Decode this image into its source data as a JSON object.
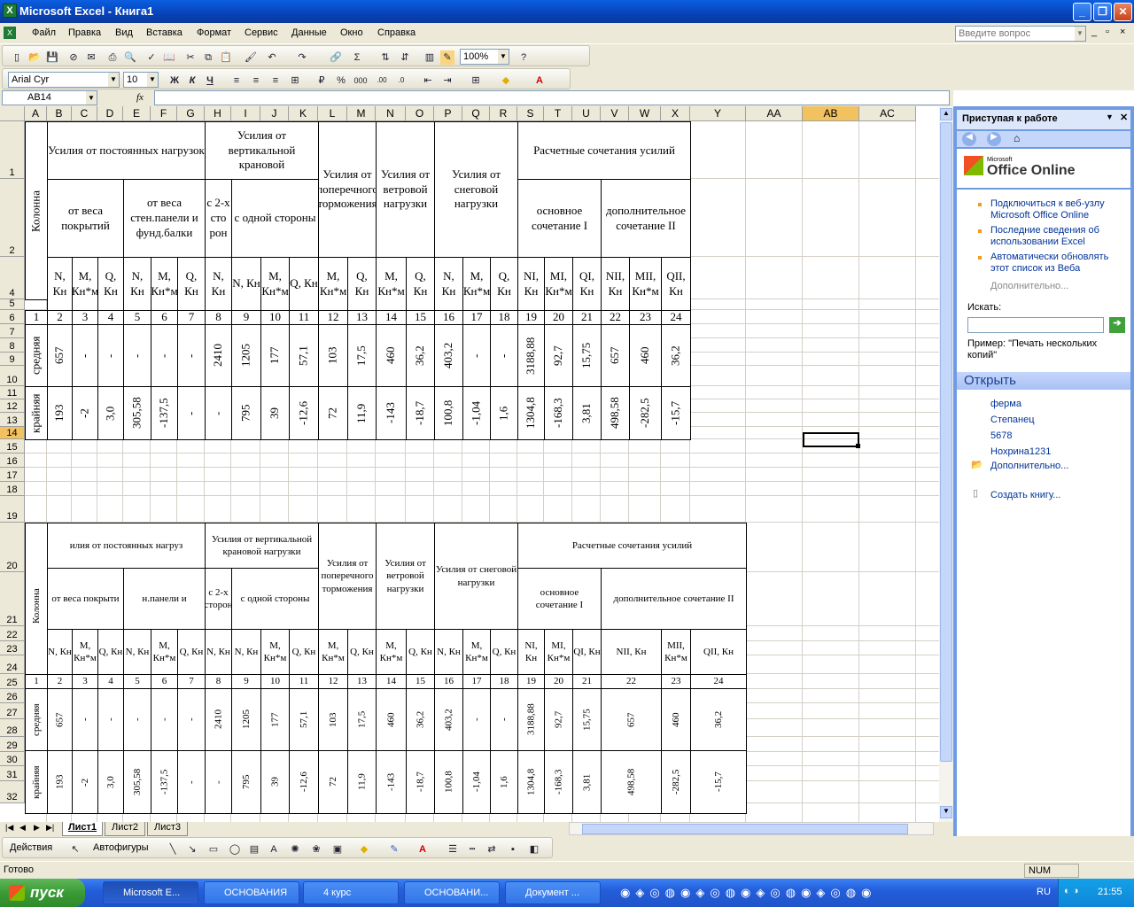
{
  "window": {
    "title": "Microsoft Excel - Книга1"
  },
  "menu": {
    "items": [
      "Файл",
      "Правка",
      "Вид",
      "Вставка",
      "Формат",
      "Сервис",
      "Данные",
      "Окно",
      "Справка"
    ],
    "help_placeholder": "Введите вопрос"
  },
  "toolbar": {
    "zoom": "100%",
    "font": "Arial Cyr",
    "size": "10",
    "bold": "Ж",
    "italic": "К",
    "underline": "Ч"
  },
  "formula_bar": {
    "name_box": "AB14",
    "fx": "fx"
  },
  "grid": {
    "columns": [
      "A",
      "B",
      "C",
      "D",
      "E",
      "F",
      "G",
      "H",
      "I",
      "J",
      "K",
      "L",
      "M",
      "N",
      "O",
      "P",
      "Q",
      "R",
      "S",
      "T",
      "U",
      "V",
      "W",
      "X",
      "Y",
      "AA",
      "AB",
      "AC"
    ],
    "selected_column": "AB",
    "rows": [
      "1",
      "2",
      "4",
      "5",
      "6",
      "7",
      "8",
      "9",
      "10",
      "11",
      "12",
      "13",
      "14",
      "15",
      "16",
      "17",
      "18",
      "19",
      "20",
      "21",
      "22",
      "23",
      "24",
      "25",
      "26",
      "27",
      "28",
      "29",
      "30",
      "31",
      "32"
    ],
    "selected_row": "14"
  },
  "table1": {
    "kolonna": "Колонна",
    "h_post": "Усилия от постоянных нагрузок",
    "h_vert": "Усилия от вертикальной крановой",
    "h_poper": "Усилия от поперечного торможения",
    "h_veter": "Усилия от ветровой нагрузки",
    "h_sneg": "Усилия от снеговой нагрузки",
    "h_rasch": "Расчетные сочетания усилий",
    "h_ves_pokr": "от веса покрытий",
    "h_ves_sten": "от веса стен.панели и фунд.балки",
    "h_2x": "с 2-х сто рон",
    "h_odnoy": "с одной стороны",
    "h_osn": "основное сочетание I",
    "h_dop": "дополнительное сочетание II",
    "labels": [
      "N, Кн",
      "M, Кн*м",
      "Q, Кн",
      "N, Кн",
      "M, Кн*м",
      "Q, Кн",
      "N, Кн",
      "N, Кн",
      "M, Кн*м",
      "Q, Кн",
      "M, Кн*м",
      "Q, Кн",
      "M, Кн*м",
      "Q, Кн",
      "N, Кн",
      "M, Кн*м",
      "Q, Кн",
      "NI, Кн",
      "MI, Кн*м",
      "QI, Кн",
      "NII, Кн",
      "MII, Кн*м",
      "QII, Кн"
    ],
    "nums": [
      "1",
      "2",
      "3",
      "4",
      "5",
      "6",
      "7",
      "8",
      "9",
      "10",
      "11",
      "12",
      "13",
      "14",
      "15",
      "16",
      "17",
      "18",
      "19",
      "20",
      "21",
      "22",
      "23",
      "24"
    ],
    "row_sred_label": "средняя",
    "row_sred": [
      "657",
      "-",
      "-",
      "-",
      "-",
      "-",
      "2410",
      "1205",
      "177",
      "57,1",
      "103",
      "17,5",
      "460",
      "36,2",
      "403,2",
      "-",
      "-",
      "3188,88",
      "92,7",
      "15,75",
      "657",
      "460",
      "36,2"
    ],
    "row_kray_label": "крайняя",
    "row_kray": [
      "193",
      "-2",
      "3,0",
      "305,58",
      "-137,5",
      "-",
      "-",
      "795",
      "39",
      "-12,6",
      "72",
      "11,9",
      "-143",
      "-18,7",
      "100,8",
      "-1,04",
      "1,6",
      "1304,8",
      "-168,3",
      "3,81",
      "498,58",
      "-282,5",
      "-15,7"
    ]
  },
  "table2": {
    "h_post": "илия от постоянных нагруз",
    "h_vert": "Усилия от вертикальной крановой нагрузки",
    "h_poper": "Усилия от поперечного торможения",
    "h_veter": "Усилия от ветровой нагрузки",
    "h_sneg": "Усилия от снеговой нагрузки",
    "h_rasch": "Расчетные сочетания усилий",
    "h_ves_pokr": "от веса покрыти",
    "h_ves_sten": "н.панели и",
    "h_2x": "с 2-х сторон",
    "h_odnoy": "с одной стороны",
    "h_osn": "основное сочетание I",
    "h_dop": "дополнительное сочетание II",
    "labels": [
      "N, Кн",
      "M, Кн*м",
      "Q, Кн",
      "N, Кн",
      "M, Кн*м",
      "Q, Кн",
      "N, Кн",
      "N, Кн",
      "M, Кн*м",
      "Q, Кн",
      "M, Кн*м",
      "Q, Кн",
      "M, Кн*м",
      "Q, Кн",
      "N, Кн",
      "M, Кн*м",
      "Q, Кн",
      "NI, Кн",
      "MI, Кн*м",
      "QI, Кн",
      "NII, Кн",
      "MII, Кн*м",
      "QII, Кн"
    ],
    "row_sred": [
      "657",
      "-",
      "-",
      "-",
      "-",
      "-",
      "2410",
      "1205",
      "177",
      "57,1",
      "103",
      "17,5",
      "460",
      "36,2",
      "403,2",
      "-",
      "-",
      "3188,88",
      "92,7",
      "15,75",
      "657",
      "460",
      "36,2"
    ],
    "row_kray": [
      "193",
      "-2",
      "3,0",
      "305,58",
      "-137,5",
      "-",
      "-",
      "795",
      "39",
      "-12,6",
      "72",
      "11,9",
      "-143",
      "-18,7",
      "100,8",
      "-1,04",
      "1,6",
      "1304,8",
      "-168,3",
      "3,81",
      "498,58",
      "-282,5",
      "-15,7"
    ]
  },
  "sheets": {
    "tabs": [
      "Лист1",
      "Лист2",
      "Лист3"
    ],
    "active": "Лист1"
  },
  "draw": {
    "actions": "Действия",
    "autoshapes": "Автофигуры"
  },
  "status": {
    "text": "Готово",
    "num": "NUM"
  },
  "taskpane": {
    "title": "Приступая к работе",
    "office_online": "Office Online",
    "microsoft": "Microsoft",
    "links": [
      "Подключиться к веб-узлу Microsoft Office Online",
      "Последние сведения об использовании Excel",
      "Автоматически обновлять этот список из Веба"
    ],
    "more": "Дополнительно...",
    "search_label": "Искать:",
    "example": "Пример:  \"Печать нескольких копий\"",
    "open_title": "Открыть",
    "files": [
      "ферма",
      "Степанец",
      "5678",
      "Нохрина1231"
    ],
    "more_files": "Дополнительно...",
    "create": "Создать книгу..."
  },
  "taskbar": {
    "start": "пуск",
    "tasks": [
      "Microsoft E...",
      "ОСНОВАНИЯ",
      "4 курс",
      "ОСНОВАНИ...",
      "Документ ..."
    ],
    "lang": "RU",
    "clock": "21:55"
  }
}
